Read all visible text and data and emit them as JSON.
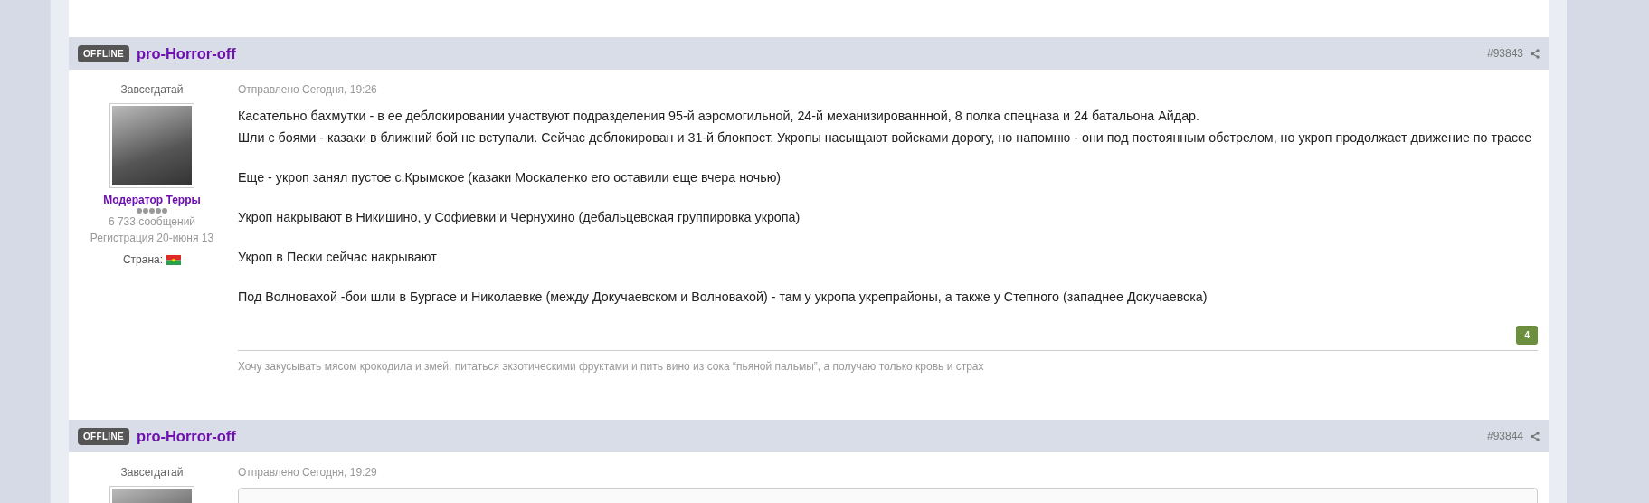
{
  "posts": [
    {
      "status_badge": "OFFLINE",
      "username": "pro-Horror-off",
      "post_number": "#93843",
      "user": {
        "title": "Завсегдатай",
        "group": "Модератор Терры",
        "stars": 5,
        "posts_count": "6 733 сообщений",
        "registered": "Регистрация 20-июня 13",
        "country_label": "Страна:"
      },
      "posted": "Отправлено Сегодня, 19:26",
      "paragraphs": [
        [
          "Касательно бахмутки - в ее деблокировании участвуют подразделения 95-й аэромогильной, 24-й механизированнной, 8 полка спецназа и 24 батальона Айдар.",
          "Шли с боями - казаки в ближний бой не вступали. Сейчас деблокирован и 31-й блокпост. Укропы насыщают войсками дорогу, но напомню - они под постоянным обстрелом, но укроп продолжает движение по трассе"
        ],
        [
          "Еще - укроп занял пустое с.Крымское (казаки Москаленко его оставили еще вчера ночью)"
        ],
        [
          "Укроп накрывают в Никишино, у Софиевки и Чернухино (дебальцевская группировка укропа)"
        ],
        [
          "Укроп в Пески сейчас накрывают"
        ],
        [
          "Под Волновахой -бои шли в Бургасе и Николаевке (между Докучаевском и Волновахой) - там у укропа укрепрайоны, а также у Степного (западнее Докучаевска)"
        ]
      ],
      "reputation": "4",
      "signature": "Хочу закусывать мясом крокодила и змей, питаться экзотическими фруктами и пить вино из сока “пьяной пальмы”, а получаю только кровь и страх"
    },
    {
      "status_badge": "OFFLINE",
      "username": "pro-Horror-off",
      "post_number": "#93844",
      "user": {
        "title": "Завсегдатай"
      },
      "posted": "Отправлено Сегодня, 19:29",
      "quote_box": true
    }
  ]
}
